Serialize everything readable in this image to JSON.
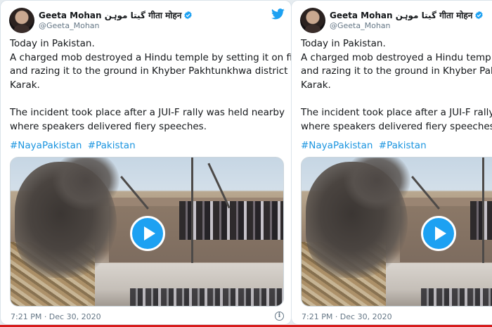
{
  "colors": {
    "accent": "#1da1f2",
    "hashtag": "#1b95e0",
    "secondary_text": "#657786",
    "bottom_bar": "#d71a1a"
  },
  "tweets": [
    {
      "display_name": "Geeta Mohan گیتا موہن गीता मोहन",
      "handle": "@Geeta_Mohan",
      "verified_icon": "verified-badge-icon",
      "brand_icon": "twitter-bird-icon",
      "text_lines": [
        "Today in Pakistan.",
        "A charged mob destroyed a Hindu temple by setting it on fire",
        "and razing it to the ground in Khyber Pakhtunkhwa district of",
        "Karak."
      ],
      "text_lines_2": [
        "The incident took place after a JUI-F rally was held nearby",
        "where speakers delivered fiery speeches."
      ],
      "hashtags": [
        "#NayaPakistan",
        "#Pakistan"
      ],
      "media_icon": "play-icon",
      "timestamp": "7:21 PM · Dec 30, 2020",
      "info_icon": "info-icon"
    },
    {
      "display_name": "Geeta Mohan گیتا موہن गीता मोहन",
      "handle": "@Geeta_Mohan",
      "verified_icon": "verified-badge-icon",
      "text_lines": [
        "Today in Pakistan.",
        "A charged mob destroyed a Hindu temple b",
        "and razing it to the ground in Khyber Pakht",
        "Karak."
      ],
      "text_lines_2": [
        "The incident took place after a JUI-F rally wa",
        "where speakers delivered fiery speeches."
      ],
      "hashtags": [
        "#NayaPakistan",
        "#Pakistan"
      ],
      "media_icon": "play-icon",
      "timestamp": "7:21 PM · Dec 30, 2020"
    }
  ]
}
